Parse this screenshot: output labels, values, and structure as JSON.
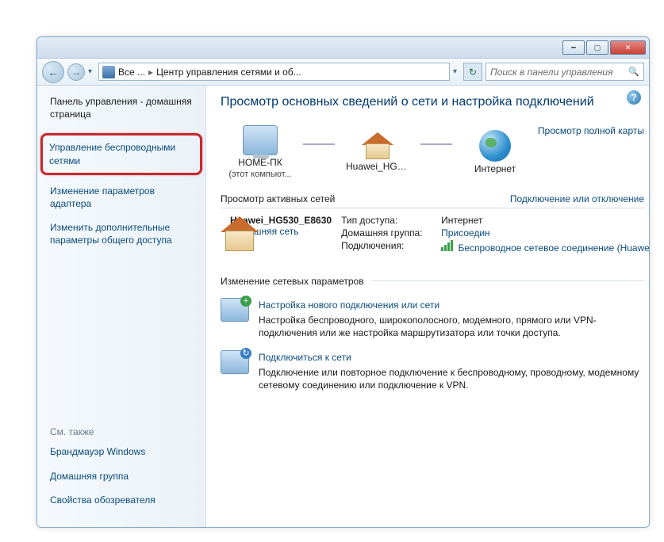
{
  "breadcrumb": {
    "root": "Все ...",
    "current": "Центр управления сетями и об..."
  },
  "search": {
    "placeholder": "Поиск в панели управления"
  },
  "sidebar": {
    "home": "Панель управления - домашняя страница",
    "items": [
      "Управление беспроводными сетями",
      "Изменение параметров адаптера",
      "Изменить дополнительные параметры общего доступа"
    ],
    "see_also_header": "См. также",
    "see_also": [
      "Брандмауэр Windows",
      "Домашняя группа",
      "Свойства обозревателя"
    ]
  },
  "content": {
    "heading": "Просмотр основных сведений о сети и настройка подключений",
    "full_map": "Просмотр полной карты",
    "map": {
      "pc_label": "HOME-ПК",
      "pc_sub": "(этот компьют...",
      "router_label": "Huawei_HG530...",
      "internet_label": "Интернет"
    },
    "active_networks_header": "Просмотр активных сетей",
    "connect_disconnect": "Подключение или отключение",
    "network": {
      "name": "Huawei_HG530_E8630",
      "type": "Домашняя сеть",
      "access_label": "Тип доступа:",
      "access_value": "Интернет",
      "homegroup_label": "Домашняя группа:",
      "homegroup_value": "Присоедин",
      "connections_label": "Подключения:",
      "connections_value": "Беспроводное сетевое соединение (Huawei_HG"
    },
    "settings_header": "Изменение сетевых параметров",
    "task1": {
      "title": "Настройка нового подключения или сети",
      "desc": "Настройка беспроводного, широкополосного, модемного, прямого или VPN-подключения или же настройка маршрутизатора или точки доступа."
    },
    "task2": {
      "title": "Подключиться к сети",
      "desc": "Подключение или повторное подключение к беспроводному, проводному, модемному сетевому соединению или подключение к VPN."
    }
  }
}
